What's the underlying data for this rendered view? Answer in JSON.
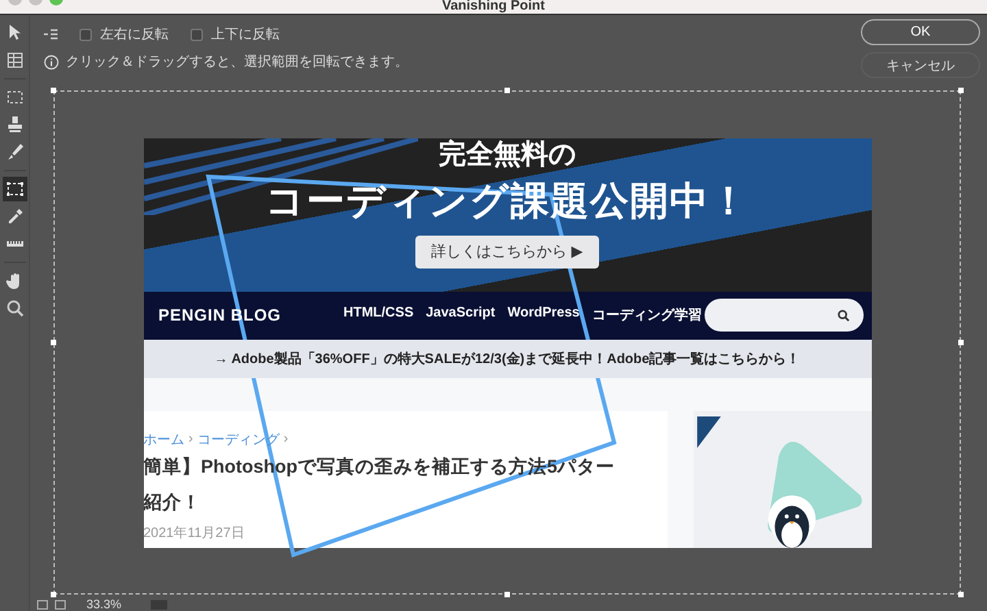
{
  "window": {
    "title": "Vanishing Point"
  },
  "tools": [
    {
      "kind": "pointer",
      "selected": false
    },
    {
      "kind": "grid",
      "selected": false
    },
    {
      "kind": "marquee",
      "selected": false
    },
    {
      "kind": "stamp",
      "selected": false
    },
    {
      "kind": "brush",
      "selected": false
    },
    {
      "kind": "transform",
      "selected": true
    },
    {
      "kind": "eyedropper",
      "selected": false
    },
    {
      "kind": "ruler",
      "selected": false
    },
    {
      "kind": "hand",
      "selected": false
    },
    {
      "kind": "zoom",
      "selected": false
    }
  ],
  "options": {
    "checkboxes": [
      {
        "label": "左右に反転",
        "checked": false
      },
      {
        "label": "上下に反転",
        "checked": false
      }
    ],
    "hint": "クリック＆ドラッグすると、選択範囲を回転できます。"
  },
  "buttons": [
    {
      "label": "OK",
      "kind": "default"
    },
    {
      "label": "キャンセル",
      "kind": "normal"
    }
  ],
  "preview": {
    "banner": {
      "line_1": "完全無料の",
      "line_2": "コーディング課題公開中！",
      "button": "詳しくはこちらから ▶"
    },
    "nav": {
      "logo": "PENGIN BLOG",
      "links": [
        "HTML/CSS",
        "JavaScript",
        "WordPress",
        "コーディング学習"
      ]
    },
    "notice": "→ Adobe製品「36%OFF」の特大SALEが12/3(金)まで延長中！Adobe記事一覧はこちらから！",
    "article": {
      "breadcrumbs": [
        {
          "label": "ホーム",
          "separator": "›"
        },
        {
          "label": "コーディング",
          "separator": "›"
        }
      ],
      "title_lines": [
        "簡単】Photoshopで写真の歪みを補正する方法5パター",
        "紹介！"
      ],
      "date": "2021年11月27日"
    }
  },
  "status": {
    "zoom": "33.3%"
  }
}
